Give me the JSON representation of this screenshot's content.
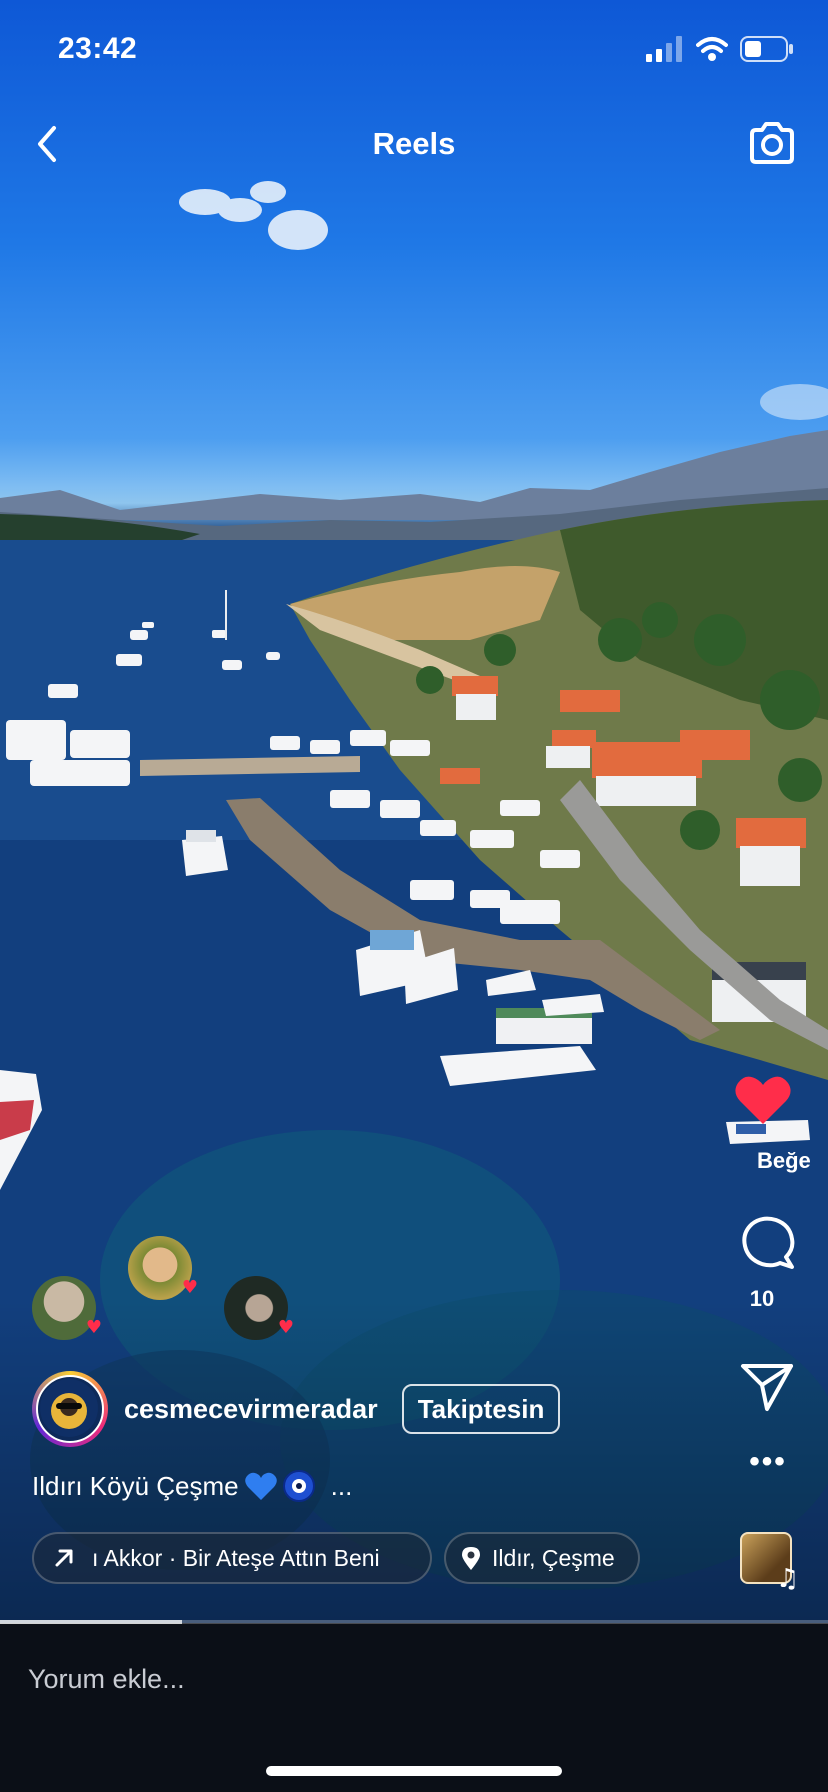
{
  "status_bar": {
    "time": "23:42"
  },
  "nav": {
    "title": "Reels"
  },
  "actions": {
    "like_label": "Beğe",
    "comment_count": "10"
  },
  "post": {
    "author": "cesmecevirmeradar",
    "follow_label": "Takiptesin",
    "caption_text": "Ildırı Köyü Çeşme",
    "caption_more": "...",
    "music": "ı Akkor · Bir Ateşe Attın Beni",
    "location": "Ildır, Çeşme",
    "progress": 0.22
  },
  "comment_bar": {
    "placeholder": "Yorum ekle..."
  },
  "colors": {
    "like_red": "#ff2d4a",
    "sea": "#123f7e",
    "sky": "#1f78e6"
  },
  "icons": [
    "back-arrow-icon",
    "camera-icon",
    "heart-icon",
    "comment-icon",
    "send-icon",
    "more-icon",
    "music-note-icon",
    "arrow-up-right-icon",
    "location-pin-icon"
  ]
}
